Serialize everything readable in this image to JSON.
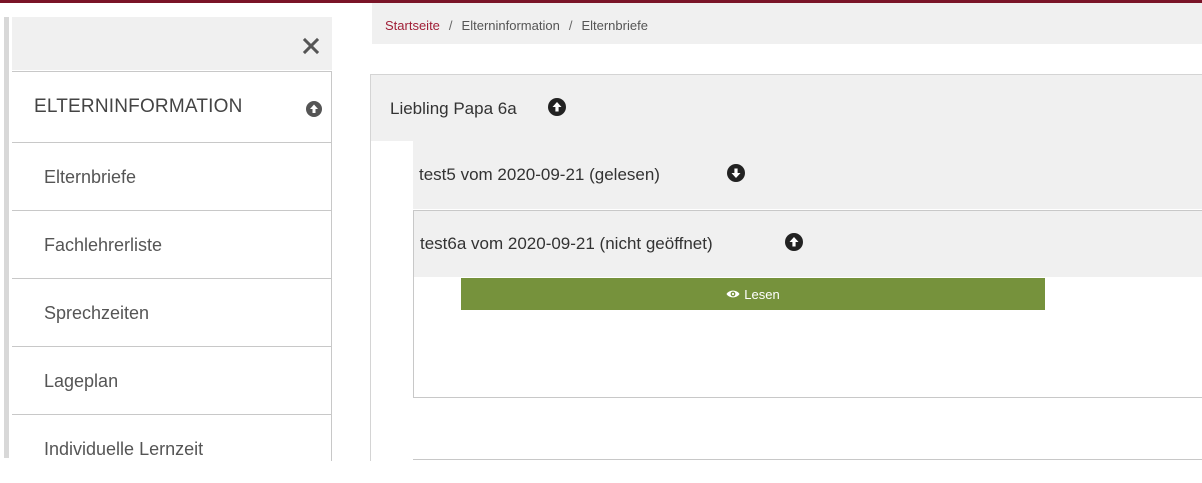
{
  "sidebar": {
    "close_icon": "close-icon",
    "section": {
      "label": "ELTERNINFORMATION",
      "toggle_icon": "circle-arrow-up-icon"
    },
    "items": [
      {
        "label": "Elternbriefe"
      },
      {
        "label": "Fachlehrerliste"
      },
      {
        "label": "Sprechzeiten"
      },
      {
        "label": "Lageplan"
      },
      {
        "label": "Individuelle Lernzeit"
      }
    ]
  },
  "breadcrumb": {
    "items": [
      "Startseite",
      "Elterninformation",
      "Elternbriefe"
    ],
    "separator": "/"
  },
  "main": {
    "group": {
      "title": "Liebling Papa 6a",
      "icon": "circle-arrow-up-icon"
    },
    "letters": [
      {
        "title": "test5 vom 2020-09-21 (gelesen)",
        "icon": "circle-arrow-down-icon",
        "expanded": false
      },
      {
        "title": "test6a vom 2020-09-21 (nicht geöffnet)",
        "icon": "circle-arrow-up-icon",
        "expanded": true,
        "action": {
          "label": "Lesen",
          "icon": "eye-icon"
        }
      }
    ]
  },
  "colors": {
    "brand": "#7a1428",
    "link": "#a01e36",
    "button_green": "#76923c",
    "panel_bg": "#f0f0f0"
  }
}
